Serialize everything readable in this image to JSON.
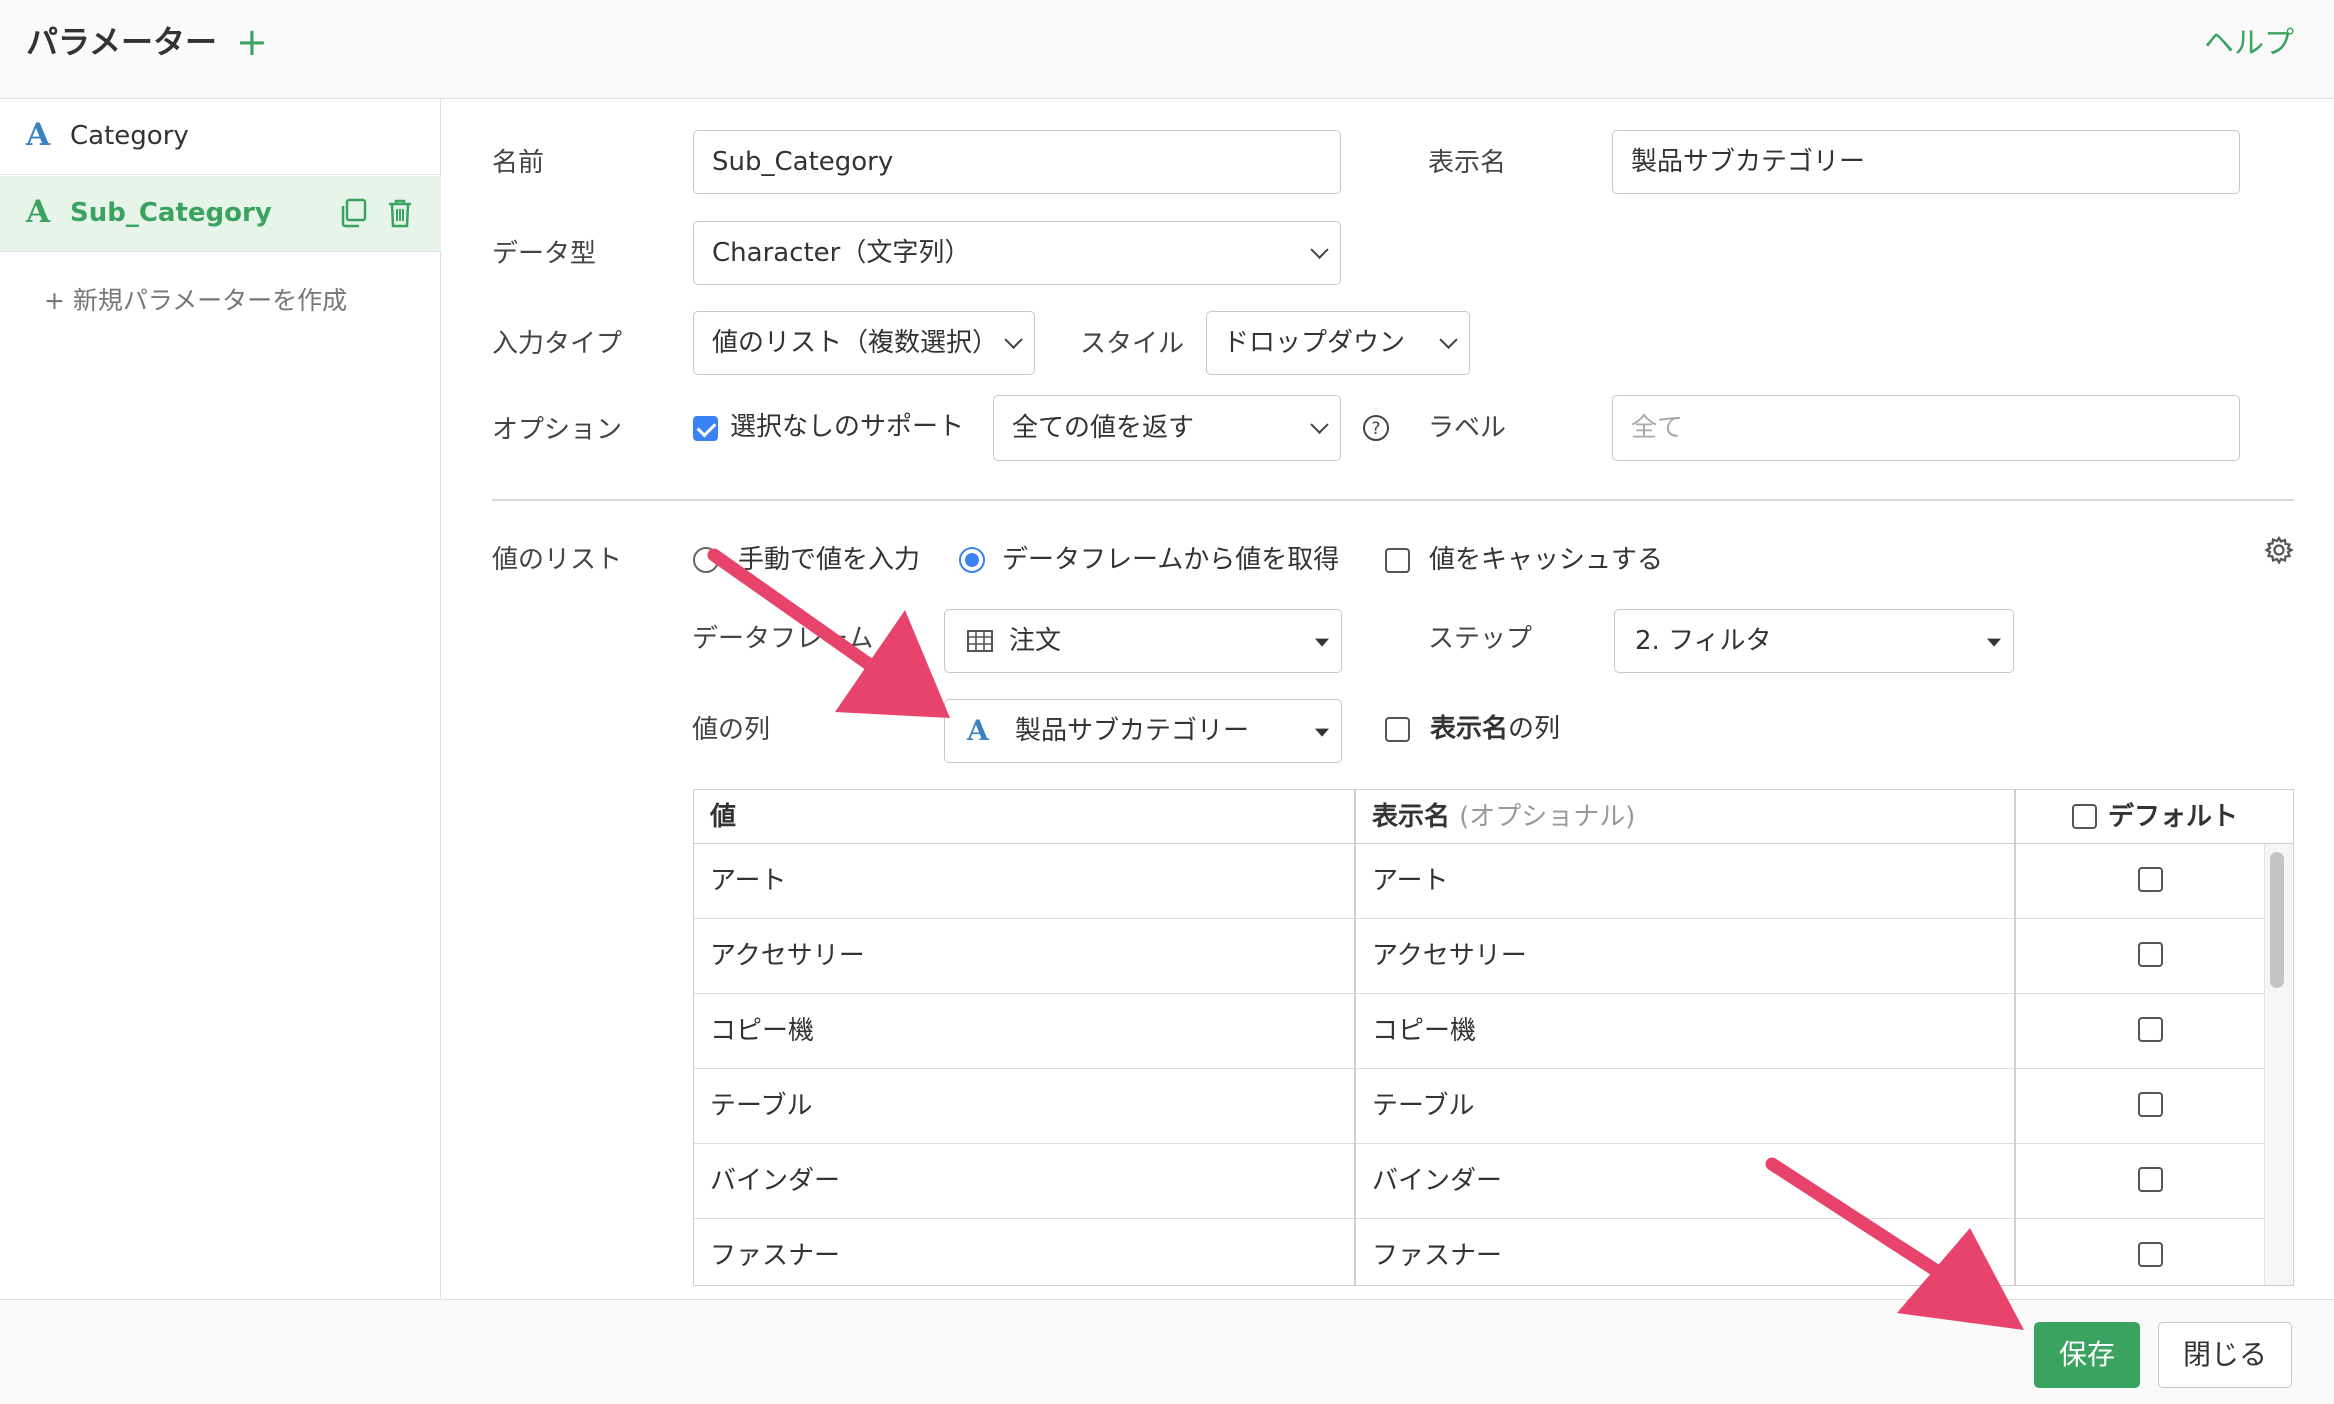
{
  "header": {
    "title": "パラメーター",
    "add_label": "+",
    "help_label": "ヘルプ"
  },
  "sidebar": {
    "items": [
      {
        "label": "Category",
        "type_icon": "A"
      },
      {
        "label": "Sub_Category",
        "type_icon": "A",
        "selected": true
      }
    ],
    "new_label": "+ 新規パラメーターを作成"
  },
  "form": {
    "name": {
      "label": "名前",
      "value": "Sub_Category"
    },
    "display_name": {
      "label": "表示名",
      "value": "製品サブカテゴリー"
    },
    "data_type": {
      "label": "データ型",
      "value": "Character（文字列）"
    },
    "input_type": {
      "label": "入力タイプ",
      "value": "値のリスト（複数選択）"
    },
    "style": {
      "label": "スタイル",
      "value": "ドロップダウン"
    },
    "options": {
      "label": "オプション",
      "support_no_selection": {
        "label": "選択なしのサポート",
        "checked": true
      },
      "return_value": "全ての値を返す",
      "help_icon": "question-circle-icon"
    },
    "label_field": {
      "label": "ラベル",
      "placeholder": "全て"
    },
    "value_list": {
      "label": "値のリスト",
      "manual": {
        "label": "手動で値を入力",
        "selected": false
      },
      "from_dataframe": {
        "label": "データフレームから値を取得",
        "selected": true
      },
      "cache": {
        "label": "値をキャッシュする",
        "checked": false
      }
    },
    "dataframe": {
      "label": "データフレーム",
      "value": "注文",
      "icon": "table-icon"
    },
    "step": {
      "label": "ステップ",
      "value": "2. フィルタ"
    },
    "value_column": {
      "label": "値の列",
      "value": "製品サブカテゴリー",
      "icon": "A"
    },
    "display_column": {
      "label_bold": "表示名",
      "label_rest": "の列",
      "checked": false
    }
  },
  "table": {
    "headers": {
      "value": "値",
      "display": "表示名",
      "display_optional": "(オプショナル)",
      "default": "デフォルト"
    },
    "rows": [
      {
        "value": "アート",
        "display": "アート"
      },
      {
        "value": "アクセサリー",
        "display": "アクセサリー"
      },
      {
        "value": "コピー機",
        "display": "コピー機"
      },
      {
        "value": "テーブル",
        "display": "テーブル"
      },
      {
        "value": "バインダー",
        "display": "バインダー"
      },
      {
        "value": "ファスナー",
        "display": "ファスナー"
      }
    ]
  },
  "footer": {
    "save_label": "保存",
    "close_label": "閉じる"
  },
  "colors": {
    "accent": "#3aa35f",
    "link_blue": "#3b82c4",
    "checkbox_blue": "#3b82f6",
    "arrow": "#e8436a"
  }
}
